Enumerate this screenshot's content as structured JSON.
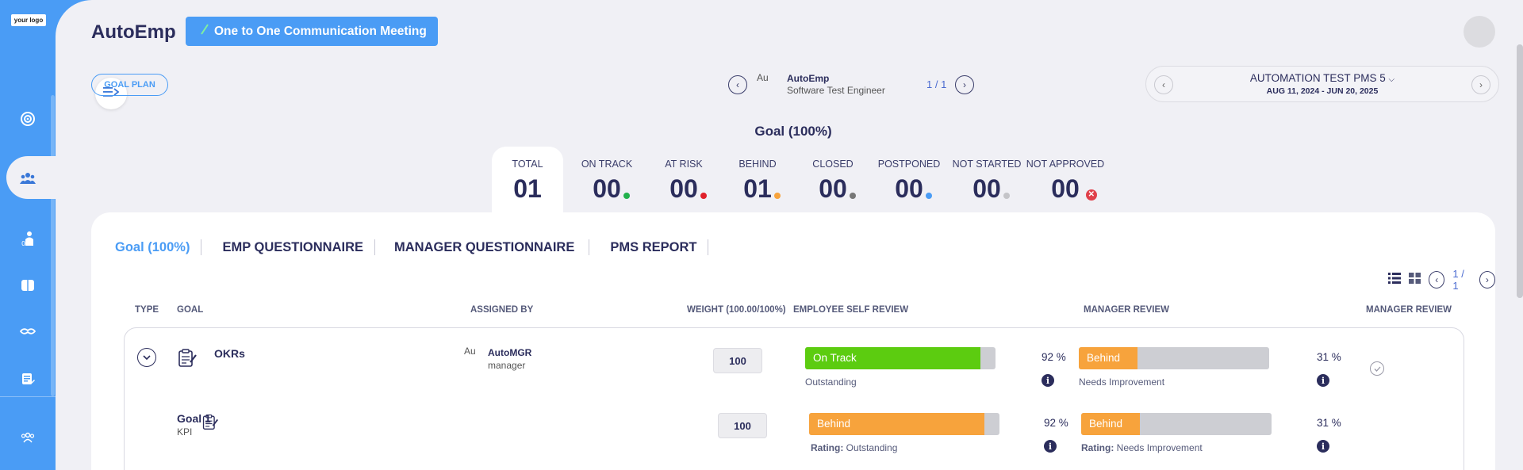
{
  "sidebar": {
    "logo_text": "your logo",
    "items": [
      {
        "icon": "target-icon"
      },
      {
        "icon": "team-icon",
        "active": true
      },
      {
        "icon": "person-stats-icon"
      },
      {
        "icon": "book-icon"
      },
      {
        "icon": "handshake-icon"
      },
      {
        "icon": "document-edit-icon"
      },
      {
        "icon": "group-icon"
      }
    ]
  },
  "header": {
    "app_title": "AutoEmp",
    "meeting_button": "One to One Communication Meeting"
  },
  "toolbar": {
    "goal_plan_label": "GOAL PLAN",
    "employee": {
      "avatar_alt": "Au",
      "name": "AutoEmp",
      "role": "Software Test Engineer",
      "pagination": "1 / 1"
    },
    "period": {
      "title": "AUTOMATION TEST PMS 5",
      "dates": "AUG 11, 2024 - JUN 20, 2025"
    }
  },
  "summary": {
    "heading": "Goal (100%)",
    "stats": [
      {
        "label": "TOTAL",
        "value": "01",
        "dot": null
      },
      {
        "label": "ON TRACK",
        "value": "00",
        "dot": "#22b14c"
      },
      {
        "label": "AT RISK",
        "value": "00",
        "dot": "#e0202a"
      },
      {
        "label": "BEHIND",
        "value": "01",
        "dot": "#f7a33c"
      },
      {
        "label": "CLOSED",
        "value": "00",
        "dot": "#777777"
      },
      {
        "label": "POSTPONED",
        "value": "00",
        "dot": "#4a9cf5"
      },
      {
        "label": "NOT STARTED",
        "value": "00",
        "dot": "#c4c4c8"
      },
      {
        "label": "NOT APPROVED",
        "value": "00",
        "dot": "#e0404a"
      }
    ]
  },
  "tabs": [
    "Goal (100%)",
    "EMP QUESTIONNAIRE",
    "MANAGER QUESTIONNAIRE",
    "PMS REPORT"
  ],
  "view": {
    "pagination": "1 / 1"
  },
  "table": {
    "headers": {
      "type": "TYPE",
      "goal": "GOAL",
      "assigned_by": "ASSIGNED BY",
      "weight": "WEIGHT (100.00/100%)",
      "self_review": "EMPLOYEE SELF REVIEW",
      "manager_review": "MANAGER REVIEW",
      "manager_review2": "MANAGER REVIEW"
    },
    "parent": {
      "name": "OKRs",
      "assigned_avatar": "Au",
      "assigned_name": "AutoMGR",
      "assigned_role": "manager",
      "weight": "100",
      "self_status": "On Track",
      "self_status_color": "#5ccc10",
      "self_progress": 0.92,
      "self_pct": "92 %",
      "self_rating": "Outstanding",
      "mgr_status": "Behind",
      "mgr_status_color": "#f7a33c",
      "mgr_progress": 0.31,
      "mgr_pct": "31 %",
      "mgr_rating": "Needs Improvement"
    },
    "child": {
      "name": "Goal 1",
      "type": "KPI",
      "weight": "100",
      "self_status": "Behind",
      "self_status_color": "#f7a33c",
      "self_progress": 0.92,
      "self_pct": "92 %",
      "rating_label": "Rating:",
      "self_rating": "Outstanding",
      "mgr_status": "Behind",
      "mgr_status_color": "#f7a33c",
      "mgr_progress": 0.31,
      "mgr_pct": "31 %",
      "mgr_rating": "Needs Improvement"
    }
  }
}
